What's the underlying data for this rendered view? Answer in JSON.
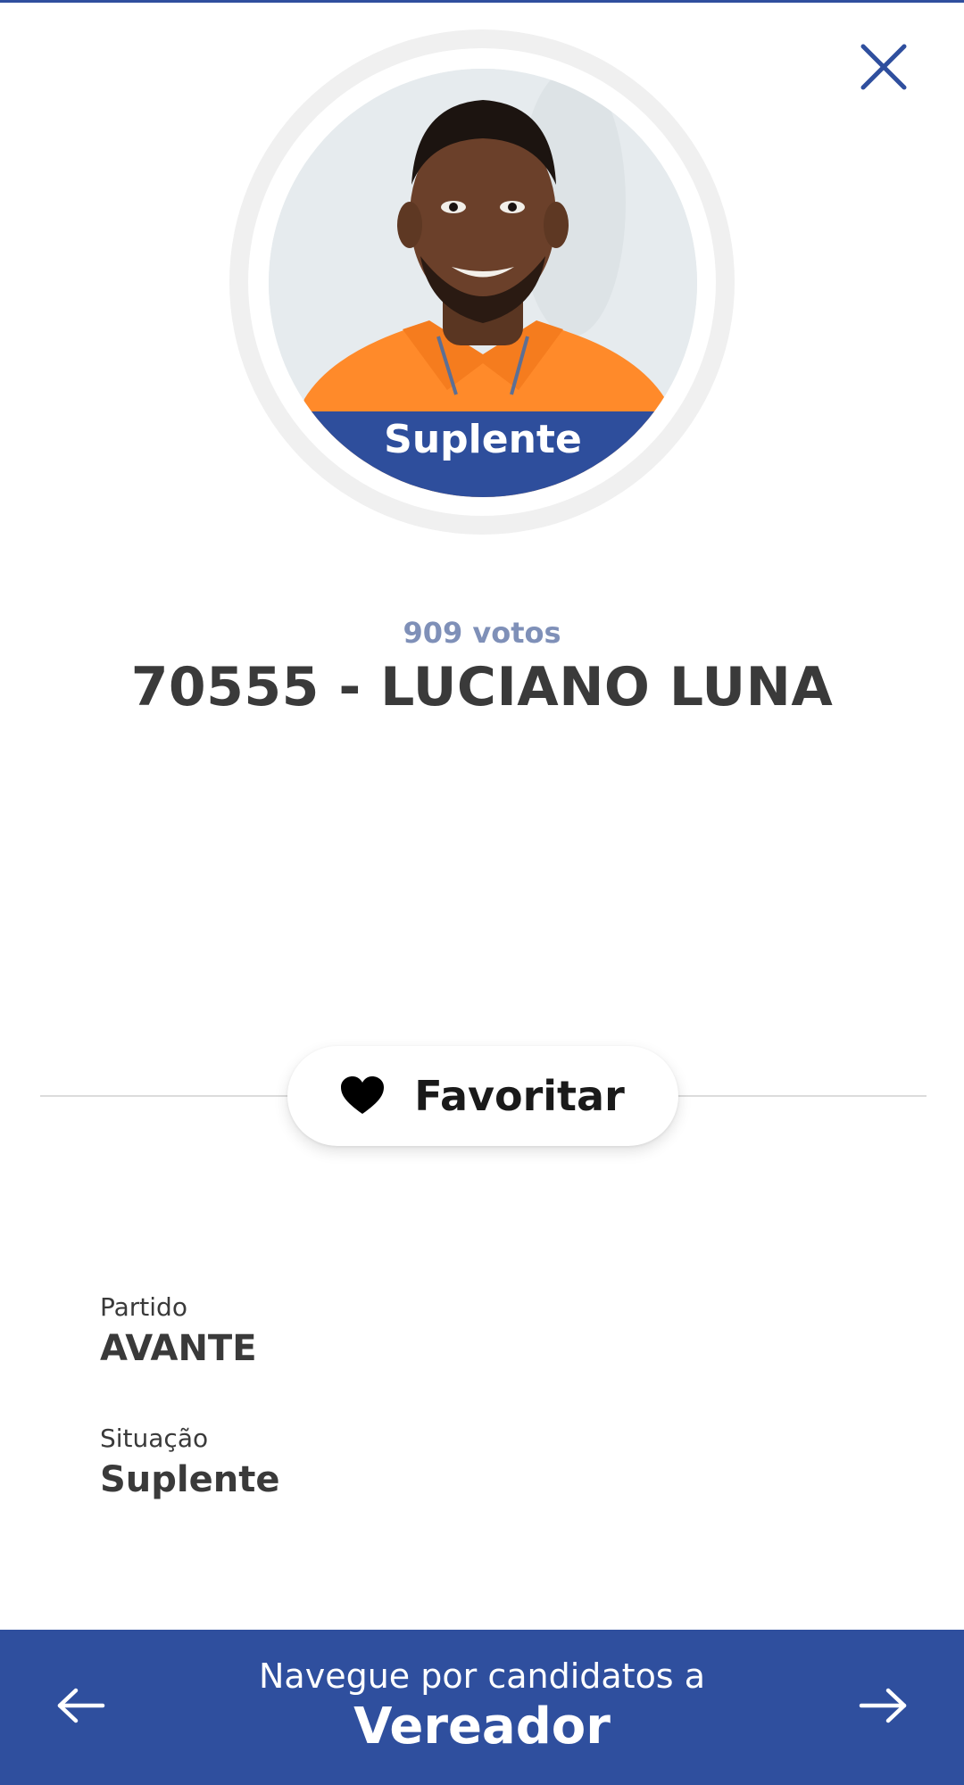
{
  "candidate": {
    "status_badge": "Suplente",
    "votes": "909 votos",
    "title": "70555 - LUCIANO LUNA"
  },
  "actions": {
    "favorite_label": "Favoritar"
  },
  "details": {
    "party_label": "Partido",
    "party_value": "AVANTE",
    "situation_label": "Situação",
    "situation_value": "Suplente"
  },
  "bottom_nav": {
    "subtitle": "Navegue por candidatos a",
    "category": "Vereador"
  },
  "icons": {
    "close": "close-icon",
    "favorite": "heart-icon",
    "prev": "arrow-left-icon",
    "next": "arrow-right-icon"
  },
  "colors": {
    "primary": "#2f4f9e",
    "votes_text": "#7f90b8",
    "text": "#3a3a3a"
  }
}
